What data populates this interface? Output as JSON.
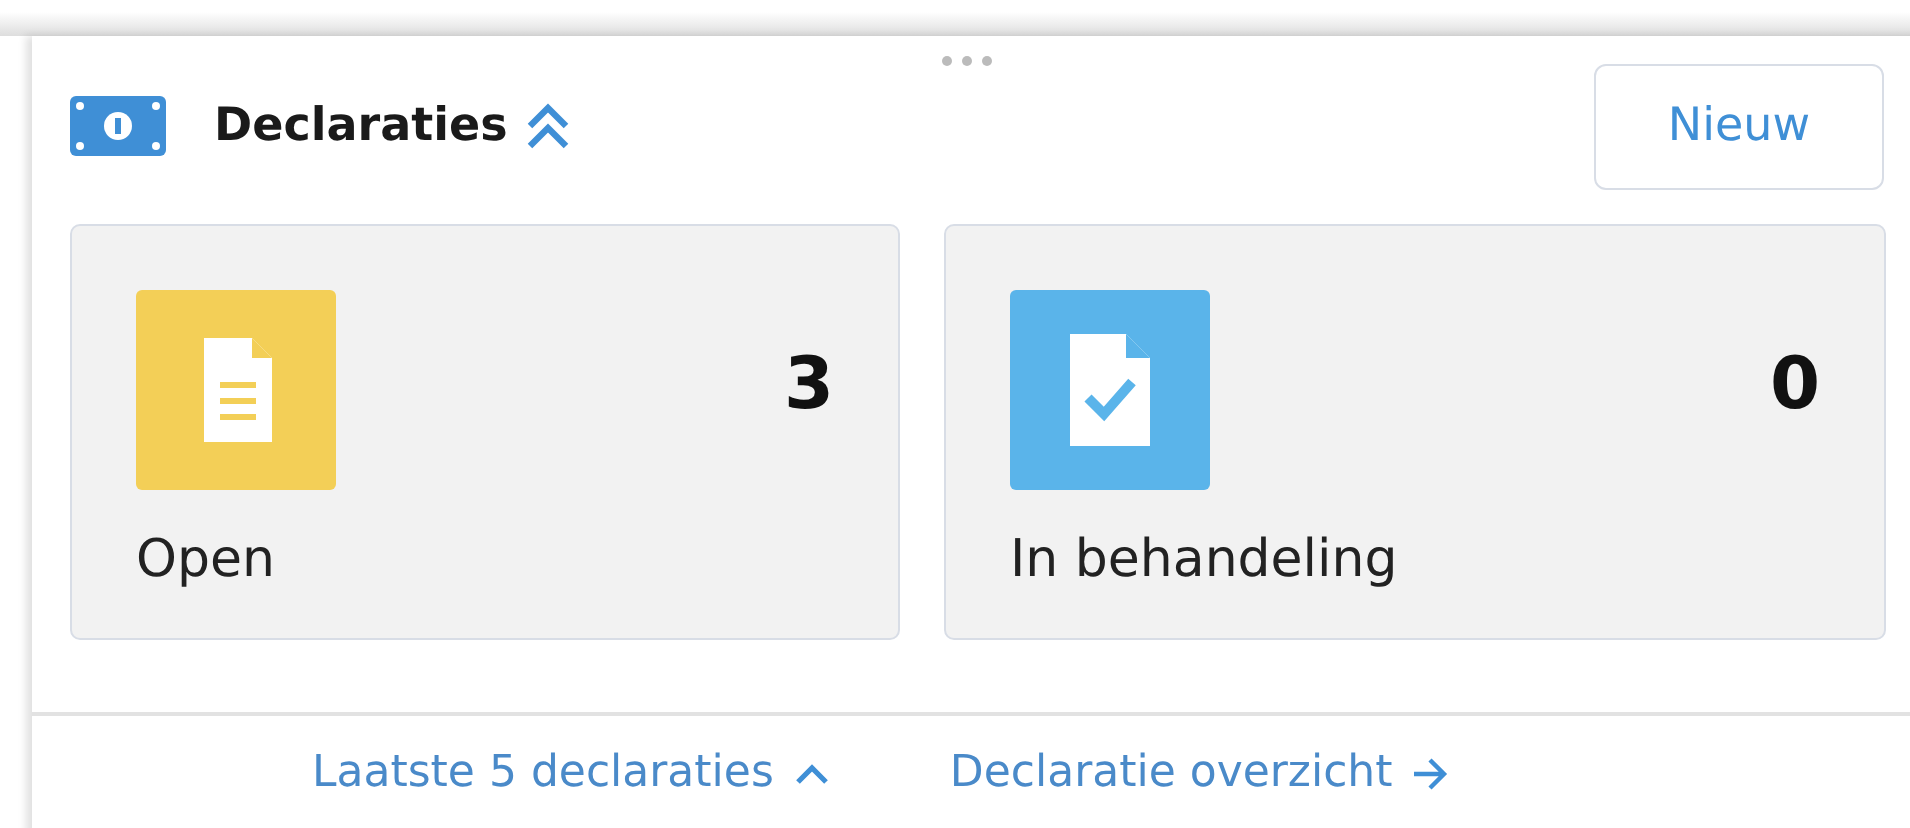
{
  "card": {
    "title": "Declaraties",
    "expanded": true,
    "action_button": "Nieuw"
  },
  "tiles": [
    {
      "kind": "open",
      "count": "3",
      "label": "Open"
    },
    {
      "kind": "in-progress",
      "count": "0",
      "label": "In behandeling"
    }
  ],
  "footer_links": [
    {
      "kind": "toggle",
      "label": "Laatste 5 declaraties",
      "expanded": true
    },
    {
      "kind": "navigate",
      "label": "Declaratie overzicht"
    }
  ]
}
